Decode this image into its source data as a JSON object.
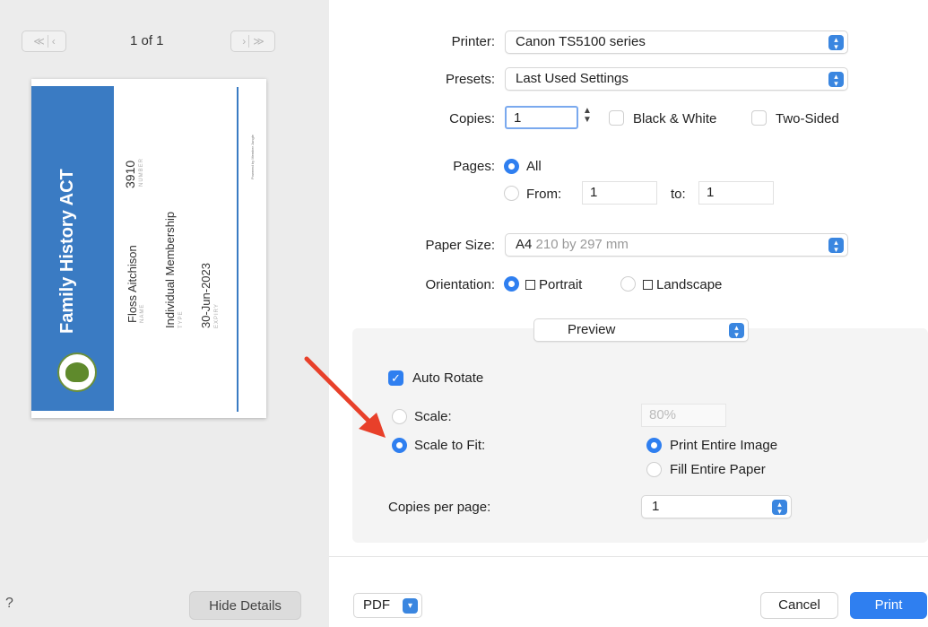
{
  "preview": {
    "page_indicator": "1 of 1",
    "nav_prev_glyph": "≪ | ‹",
    "nav_next_glyph": "› | ≫",
    "card": {
      "title": "Family History ACT",
      "number": "3910",
      "number_label": "NUMBER",
      "name": "Floss Aitchison",
      "name_label": "NAME",
      "type": "Individual Membership",
      "type_label": "TYPE",
      "expiry": "30-Jun-2023",
      "expiry_label": "EXPIRY",
      "credit": "Powered by Member Jungle",
      "band_color": "#3a7bc3"
    },
    "help_label": "?",
    "hide_details_label": "Hide Details"
  },
  "settings": {
    "printer": {
      "label": "Printer:",
      "value": "Canon TS5100 series"
    },
    "presets": {
      "label": "Presets:",
      "value": "Last Used Settings"
    },
    "copies": {
      "label": "Copies:",
      "value": "1",
      "black_white_label": "Black & White",
      "black_white_checked": false,
      "two_sided_label": "Two-Sided",
      "two_sided_checked": false
    },
    "pages": {
      "label": "Pages:",
      "all_label": "All",
      "all_selected": true,
      "from_label": "From:",
      "from_value": "1",
      "to_label": "to:",
      "to_value": "1"
    },
    "paper_size": {
      "label": "Paper Size:",
      "value": "A4",
      "detail": "210 by 297 mm"
    },
    "orientation": {
      "label": "Orientation:",
      "portrait_label": "Portrait",
      "portrait_selected": true,
      "landscape_label": "Landscape"
    },
    "section_popup": {
      "value": "Preview"
    },
    "preview_options": {
      "auto_rotate_label": "Auto Rotate",
      "auto_rotate_checked": true,
      "scale_label": "Scale:",
      "scale_value": "80%",
      "scale_to_fit_label": "Scale to Fit:",
      "scale_to_fit_selected": true,
      "print_entire_image_label": "Print Entire Image",
      "print_entire_image_selected": true,
      "fill_entire_paper_label": "Fill Entire Paper",
      "copies_per_page_label": "Copies per page:",
      "copies_per_page_value": "1"
    }
  },
  "footer": {
    "pdf_label": "PDF",
    "cancel_label": "Cancel",
    "print_label": "Print"
  },
  "colors": {
    "accent": "#2f7ff0",
    "annotation_arrow": "#e8402a"
  }
}
